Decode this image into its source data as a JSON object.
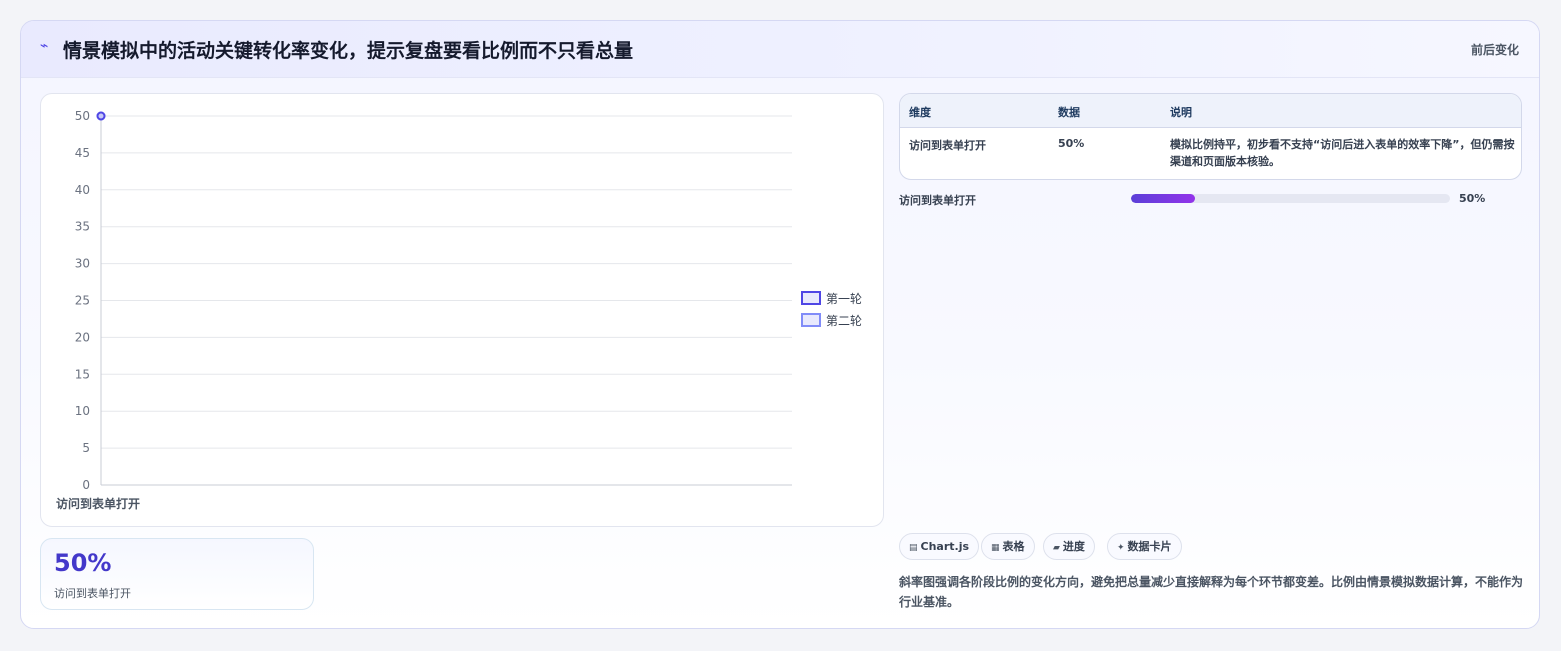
{
  "header": {
    "icon": "⌁",
    "title": "情景模拟中的活动关键转化率变化，提示复盘要看比例而不只看总量",
    "tag": "前后变化"
  },
  "chart_data": {
    "type": "line",
    "categories": [
      "访问到表单打开"
    ],
    "series": [
      {
        "name": "第一轮",
        "values": [
          50
        ]
      },
      {
        "name": "第二轮",
        "values": [
          50
        ]
      }
    ],
    "ylim": [
      0,
      50
    ],
    "yticks": [
      0,
      5,
      10,
      15,
      20,
      25,
      30,
      35,
      40,
      45,
      50
    ],
    "legend_position": "right",
    "grid": true,
    "colors": [
      "#4f46e5",
      "#818cf8"
    ]
  },
  "stat_card": {
    "value": "50%",
    "label": "访问到表单打开"
  },
  "table": {
    "headers": [
      "维度",
      "数据",
      "说明"
    ],
    "rows": [
      {
        "dimension": "访问到表单打开",
        "data": "50%",
        "note": "模拟比例持平，初步看不支持“访问后进入表单的效率下降”，但仍需按渠道和页面版本核验。"
      }
    ]
  },
  "progress": {
    "label": "访问到表单打开",
    "value_text": "50%",
    "fraction": 0.2
  },
  "chips": [
    {
      "icon": "▤",
      "icon_name": "chart-icon",
      "label": "Chart.js"
    },
    {
      "icon": "▦",
      "icon_name": "table-icon",
      "label": "表格"
    },
    {
      "icon": "▰",
      "icon_name": "progress-icon",
      "label": "进度"
    },
    {
      "icon": "✦",
      "icon_name": "card-icon",
      "label": "数据卡片"
    }
  ],
  "note": "斜率图强调各阶段比例的变化方向，避免把总量减少直接解释为每个环节都变差。比例由情景模拟数据计算，不能作为行业基准。"
}
